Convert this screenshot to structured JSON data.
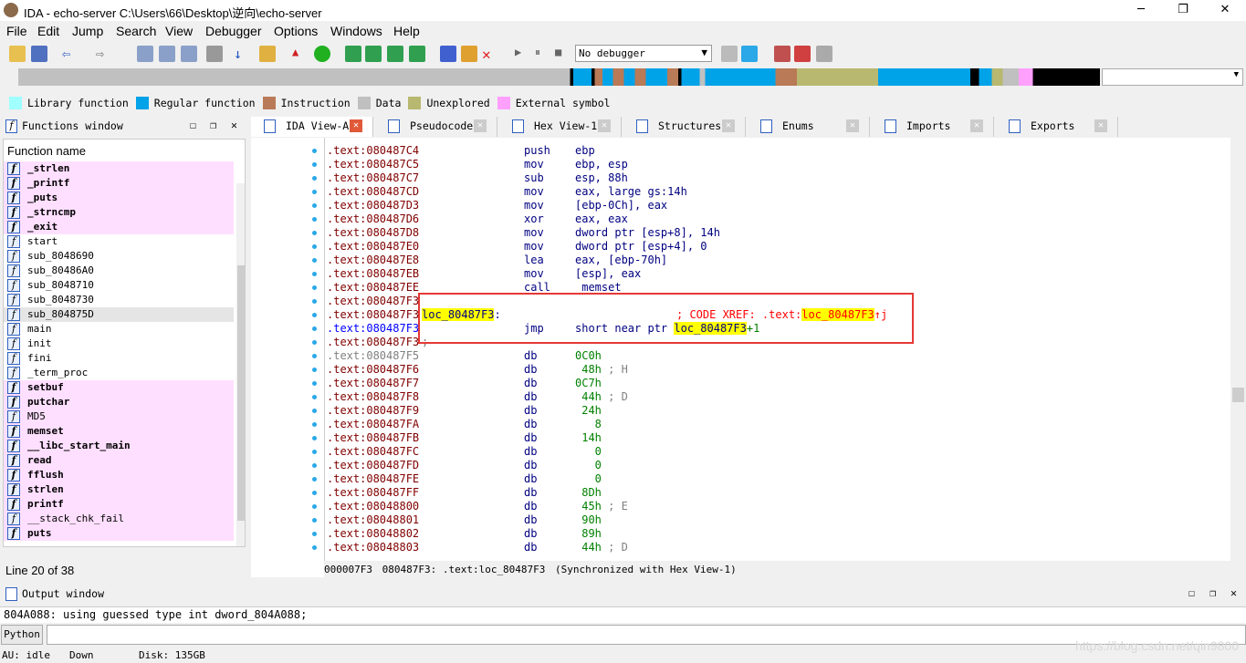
{
  "window": {
    "title": "IDA - echo-server C:\\Users\\66\\Desktop\\逆向\\echo-server",
    "minimize": "─",
    "maximize": "❐",
    "close": "✕"
  },
  "menu": [
    "File",
    "Edit",
    "Jump",
    "Search",
    "View",
    "Debugger",
    "Options",
    "Windows",
    "Help"
  ],
  "toolbar": {
    "debugger_select": "No debugger"
  },
  "legend": [
    {
      "label": "Library function",
      "color": "#a0ffff"
    },
    {
      "label": "Regular function",
      "color": "#00a2e8"
    },
    {
      "label": "Instruction",
      "color": "#b97a57"
    },
    {
      "label": "Data",
      "color": "#c0c0c0"
    },
    {
      "label": "Unexplored",
      "color": "#b8b870"
    },
    {
      "label": "External symbol",
      "color": "#ffa0ff"
    }
  ],
  "functions": {
    "title": "Functions window",
    "header": "Function name",
    "line_status": "Line 20 of 38",
    "items": [
      {
        "name": "_strlen",
        "style": "pink-bold"
      },
      {
        "name": "_printf",
        "style": "pink-bold"
      },
      {
        "name": "_puts",
        "style": "pink-bold"
      },
      {
        "name": "_strncmp",
        "style": "pink-bold"
      },
      {
        "name": "_exit",
        "style": "pink-bold"
      },
      {
        "name": "start",
        "style": ""
      },
      {
        "name": "sub_8048690",
        "style": ""
      },
      {
        "name": "sub_80486A0",
        "style": ""
      },
      {
        "name": "sub_8048710",
        "style": ""
      },
      {
        "name": "sub_8048730",
        "style": ""
      },
      {
        "name": "sub_804875D",
        "style": "selected"
      },
      {
        "name": "main",
        "style": ""
      },
      {
        "name": "init",
        "style": ""
      },
      {
        "name": "fini",
        "style": ""
      },
      {
        "name": "_term_proc",
        "style": ""
      },
      {
        "name": "setbuf",
        "style": "pink-bold"
      },
      {
        "name": "putchar",
        "style": "pink-bold"
      },
      {
        "name": "MD5",
        "style": "pink"
      },
      {
        "name": "memset",
        "style": "pink-bold"
      },
      {
        "name": "__libc_start_main",
        "style": "pink-bold"
      },
      {
        "name": "read",
        "style": "pink-bold"
      },
      {
        "name": "fflush",
        "style": "pink-bold"
      },
      {
        "name": "strlen",
        "style": "pink-bold"
      },
      {
        "name": "printf",
        "style": "pink-bold"
      },
      {
        "name": "__stack_chk_fail",
        "style": "pink"
      },
      {
        "name": "puts",
        "style": "pink-bold"
      }
    ]
  },
  "tabs": [
    "IDA View-A",
    "Pseudocode-A",
    "Hex View-1",
    "Structures",
    "Enums",
    "Imports",
    "Exports"
  ],
  "code": [
    {
      "addr": ".text:080487C4",
      "mn": "push",
      "ops": "ebp"
    },
    {
      "addr": ".text:080487C5",
      "mn": "mov",
      "ops": "ebp, esp"
    },
    {
      "addr": ".text:080487C7",
      "mn": "sub",
      "ops": "esp, 88h"
    },
    {
      "addr": ".text:080487CD",
      "mn": "mov",
      "ops": "eax, large gs:14h"
    },
    {
      "addr": ".text:080487D3",
      "mn": "mov",
      "ops": "[ebp-0Ch], eax"
    },
    {
      "addr": ".text:080487D6",
      "mn": "xor",
      "ops": "eax, eax"
    },
    {
      "addr": ".text:080487D8",
      "mn": "mov",
      "ops": "dword ptr [esp+8], 14h"
    },
    {
      "addr": ".text:080487E0",
      "mn": "mov",
      "ops": "dword ptr [esp+4], 0"
    },
    {
      "addr": ".text:080487E8",
      "mn": "lea",
      "ops": "eax, [ebp-70h]"
    },
    {
      "addr": ".text:080487EB",
      "mn": "mov",
      "ops": "[esp], eax"
    },
    {
      "addr": ".text:080487EE",
      "mn": "call",
      "ops": "_memset"
    },
    {
      "addr": ".text:080487F3",
      "mn": "",
      "ops": ""
    },
    {
      "addr": ".text:080487F3",
      "label": "loc_80487F3",
      "xref_prefix": "; CODE XREF: .text:",
      "xref_target": "loc_80487F3",
      "xref_suffix": "↑j"
    },
    {
      "addr": ".text:080487F3",
      "mn": "jmp",
      "ops": "short near ptr ",
      "ops_hl": "loc_80487F3",
      "ops_tail": "+1",
      "kind": "blue"
    },
    {
      "addr": ".text:080487F3",
      "separator": "; -----------------------------------------------------------------------"
    },
    {
      "addr": ".text:080487F5",
      "mn": "db",
      "ops": "0C0h",
      "kind": "gray"
    },
    {
      "addr": ".text:080487F6",
      "mn": "db",
      "ops": " 48h",
      "cmt": " ; H"
    },
    {
      "addr": ".text:080487F7",
      "mn": "db",
      "ops": "0C7h"
    },
    {
      "addr": ".text:080487F8",
      "mn": "db",
      "ops": " 44h",
      "cmt": " ; D"
    },
    {
      "addr": ".text:080487F9",
      "mn": "db",
      "ops": " 24h"
    },
    {
      "addr": ".text:080487FA",
      "mn": "db",
      "ops": "   8"
    },
    {
      "addr": ".text:080487FB",
      "mn": "db",
      "ops": " 14h"
    },
    {
      "addr": ".text:080487FC",
      "mn": "db",
      "ops": "   0"
    },
    {
      "addr": ".text:080487FD",
      "mn": "db",
      "ops": "   0"
    },
    {
      "addr": ".text:080487FE",
      "mn": "db",
      "ops": "   0"
    },
    {
      "addr": ".text:080487FF",
      "mn": "db",
      "ops": " 8Dh"
    },
    {
      "addr": ".text:08048800",
      "mn": "db",
      "ops": " 45h",
      "cmt": " ; E"
    },
    {
      "addr": ".text:08048801",
      "mn": "db",
      "ops": " 90h"
    },
    {
      "addr": ".text:08048802",
      "mn": "db",
      "ops": " 89h"
    },
    {
      "addr": ".text:08048803",
      "mn": "db",
      "ops": " 44h",
      "cmt": " ; D"
    }
  ],
  "code_status": {
    "offset": "000007F3",
    "location": "080487F3: .text:loc_80487F3",
    "sync": "(Synchronized with Hex View-1)"
  },
  "output": {
    "title": "Output window",
    "text": "804A088: using guessed type int dword_804A088;",
    "python_button": "Python"
  },
  "statusbar": {
    "au": "AU:  idle",
    "direction": "Down",
    "disk": "Disk: 135GB"
  },
  "watermark": "https://blog.csdn.net/qin9800"
}
